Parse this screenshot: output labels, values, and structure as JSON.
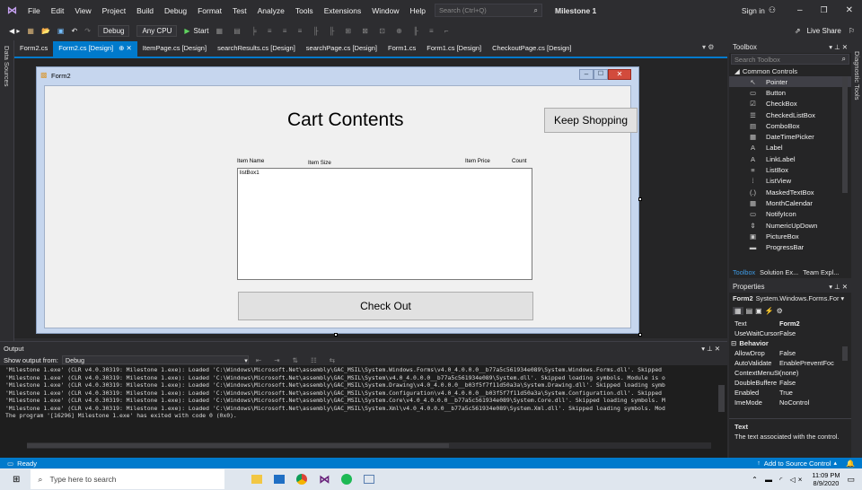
{
  "titlebar": {
    "menus": [
      "File",
      "Edit",
      "View",
      "Project",
      "Build",
      "Debug",
      "Format",
      "Test",
      "Analyze",
      "Tools",
      "Extensions",
      "Window",
      "Help"
    ],
    "search_placeholder": "Search (Ctrl+Q)",
    "solution_name": "Milestone 1",
    "sign_in": "Sign in"
  },
  "toolbar": {
    "config": "Debug",
    "platform": "Any CPU",
    "start": "Start",
    "live_share": "Live Share"
  },
  "left_strip": {
    "data_sources": "Data Sources"
  },
  "right_strip": {
    "diagnostic_tools": "Diagnostic Tools"
  },
  "doc_tabs": [
    {
      "label": "Form2.cs",
      "active": false
    },
    {
      "label": "Form2.cs [Design]",
      "active": true
    },
    {
      "label": "ItemPage.cs [Design]",
      "active": false
    },
    {
      "label": "searchResults.cs [Design]",
      "active": false
    },
    {
      "label": "searchPage.cs [Design]",
      "active": false
    },
    {
      "label": "Form1.cs",
      "active": false
    },
    {
      "label": "Form1.cs [Design]",
      "active": false
    },
    {
      "label": "CheckoutPage.cs [Design]",
      "active": false
    }
  ],
  "form": {
    "title": "Form2",
    "heading": "Cart Contents",
    "keep_shopping": "Keep Shopping",
    "col_item_name": "Item Name",
    "col_item_size": "Item Size",
    "col_item_price": "Item Price",
    "col_count": "Count",
    "listbox": "listBox1",
    "check_out": "Check Out"
  },
  "output": {
    "title": "Output",
    "show_from_label": "Show output from:",
    "show_from_value": "Debug",
    "lines": [
      "'Milestone 1.exe' (CLR v4.0.30319: Milestone 1.exe): Loaded 'C:\\Windows\\Microsoft.Net\\assembly\\GAC_MSIL\\System.Windows.Forms\\v4.0_4.0.0.0__b77a5c561934e089\\System.Windows.Forms.dll'. Skipped",
      "'Milestone 1.exe' (CLR v4.0.30319: Milestone 1.exe): Loaded 'C:\\Windows\\Microsoft.Net\\assembly\\GAC_MSIL\\System\\v4.0_4.0.0.0__b77a5c561934e089\\System.dll'. Skipped loading symbols. Module is o",
      "'Milestone 1.exe' (CLR v4.0.30319: Milestone 1.exe): Loaded 'C:\\Windows\\Microsoft.Net\\assembly\\GAC_MSIL\\System.Drawing\\v4.0_4.0.0.0__b03f5f7f11d50a3a\\System.Drawing.dll'. Skipped loading symb",
      "'Milestone 1.exe' (CLR v4.0.30319: Milestone 1.exe): Loaded 'C:\\Windows\\Microsoft.Net\\assembly\\GAC_MSIL\\System.Configuration\\v4.0_4.0.0.0__b03f5f7f11d50a3a\\System.Configuration.dll'. Skipped",
      "'Milestone 1.exe' (CLR v4.0.30319: Milestone 1.exe): Loaded 'C:\\Windows\\Microsoft.Net\\assembly\\GAC_MSIL\\System.Core\\v4.0_4.0.0.0__b77a5c561934e089\\System.Core.dll'. Skipped loading symbols. M",
      "'Milestone 1.exe' (CLR v4.0.30319: Milestone 1.exe): Loaded 'C:\\Windows\\Microsoft.Net\\assembly\\GAC_MSIL\\System.Xml\\v4.0_4.0.0.0__b77a5c561934e089\\System.Xml.dll'. Skipped loading symbols. Mod",
      "The program '[16296] Milestone 1.exe' has exited with code 0 (0x0)."
    ]
  },
  "toolbox": {
    "title": "Toolbox",
    "search_placeholder": "Search Toolbox",
    "group": "Common Controls",
    "items": [
      {
        "label": "Pointer",
        "icon": "↖"
      },
      {
        "label": "Button",
        "icon": "▭"
      },
      {
        "label": "CheckBox",
        "icon": "☑"
      },
      {
        "label": "CheckedListBox",
        "icon": "☰"
      },
      {
        "label": "ComboBox",
        "icon": "▤"
      },
      {
        "label": "DateTimePicker",
        "icon": "▦"
      },
      {
        "label": "Label",
        "icon": "A"
      },
      {
        "label": "LinkLabel",
        "icon": "A"
      },
      {
        "label": "ListBox",
        "icon": "≡"
      },
      {
        "label": "ListView",
        "icon": "⁞"
      },
      {
        "label": "MaskedTextBox",
        "icon": "(.)"
      },
      {
        "label": "MonthCalendar",
        "icon": "▦"
      },
      {
        "label": "NotifyIcon",
        "icon": "▭"
      },
      {
        "label": "NumericUpDown",
        "icon": "⇕"
      },
      {
        "label": "PictureBox",
        "icon": "▣"
      },
      {
        "label": "ProgressBar",
        "icon": "▬"
      }
    ],
    "bottom_tabs": [
      "Toolbox",
      "Solution Ex...",
      "Team Expl..."
    ]
  },
  "properties": {
    "title": "Properties",
    "object": "Form2",
    "object_type": "System.Windows.Forms.For",
    "rows_top": [
      {
        "key": "Text",
        "value": "Form2"
      },
      {
        "key": "UseWaitCursor",
        "value": "False"
      }
    ],
    "category": "Behavior",
    "rows": [
      {
        "key": "AllowDrop",
        "value": "False"
      },
      {
        "key": "AutoValidate",
        "value": "EnablePreventFoc"
      },
      {
        "key": "ContextMenuSt",
        "value": "(none)"
      },
      {
        "key": "DoubleBuffere",
        "value": "False"
      },
      {
        "key": "Enabled",
        "value": "True"
      },
      {
        "key": "ImeMode",
        "value": "NoControl"
      }
    ],
    "desc_title": "Text",
    "desc_text": "The text associated with the control."
  },
  "statusbar": {
    "ready": "Ready",
    "source_control": "Add to Source Control"
  },
  "taskbar": {
    "search_placeholder": "Type here to search",
    "time": "11:09 PM",
    "date": "8/9/2020"
  },
  "colors": {
    "accent": "#007acc",
    "vs_purple": "#68217a"
  }
}
